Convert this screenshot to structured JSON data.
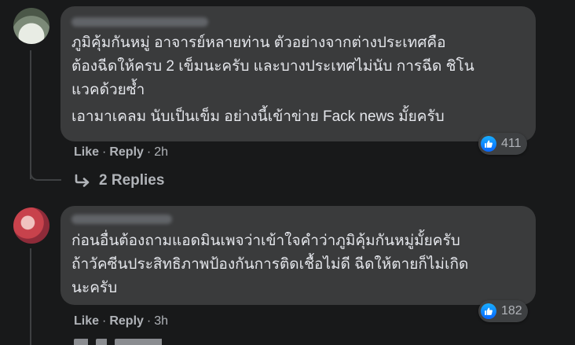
{
  "comments": [
    {
      "paragraphs": [
        {
          "lines": [
            "ภูมิคุ้มกันหมู่ อาจารย์หลายท่าน ตัวอย่างจากต่างประเทศคือ",
            "ต้องฉีดให้ครบ 2 เข็มนะครับ และบางประเทศไม่นับ การฉีด ชิโน",
            "แวคด้วยซ้ำ"
          ]
        },
        {
          "lines": [
            "เอามาเคลม นับเป็นเข็ม อย่างนี้เข้าข่าย Fack news มั้ยครับ"
          ]
        }
      ],
      "actions": {
        "like": "Like",
        "separator": "·",
        "reply": "Reply",
        "time": "2h"
      },
      "reaction_count": "411",
      "replies_label": "2 Replies"
    },
    {
      "paragraphs": [
        {
          "lines": [
            "ก่อนอื่นต้องถามแอดมินเพจว่าเข้าใจคำว่าภูมิคุ้มกันหมู่มั้ยครับ",
            "ถ้าวัคซีนประสิทธิภาพป้องกันการติดเชื้อไม่ดี ฉีดให้ตายก็ไม่เกิด",
            "นะครับ"
          ]
        }
      ],
      "actions": {
        "like": "Like",
        "separator": "·",
        "reply": "Reply",
        "time": "3h"
      },
      "reaction_count": "182"
    }
  ],
  "icons": {
    "reaction": "like-thumbs-up-icon",
    "replies": "reply-arrow-icon"
  },
  "colors": {
    "background": "#18191a",
    "bubble": "#3a3b3c",
    "text": "#e4e6eb",
    "secondary_text": "#b0b3b8",
    "like_blue": "#0866ff"
  }
}
